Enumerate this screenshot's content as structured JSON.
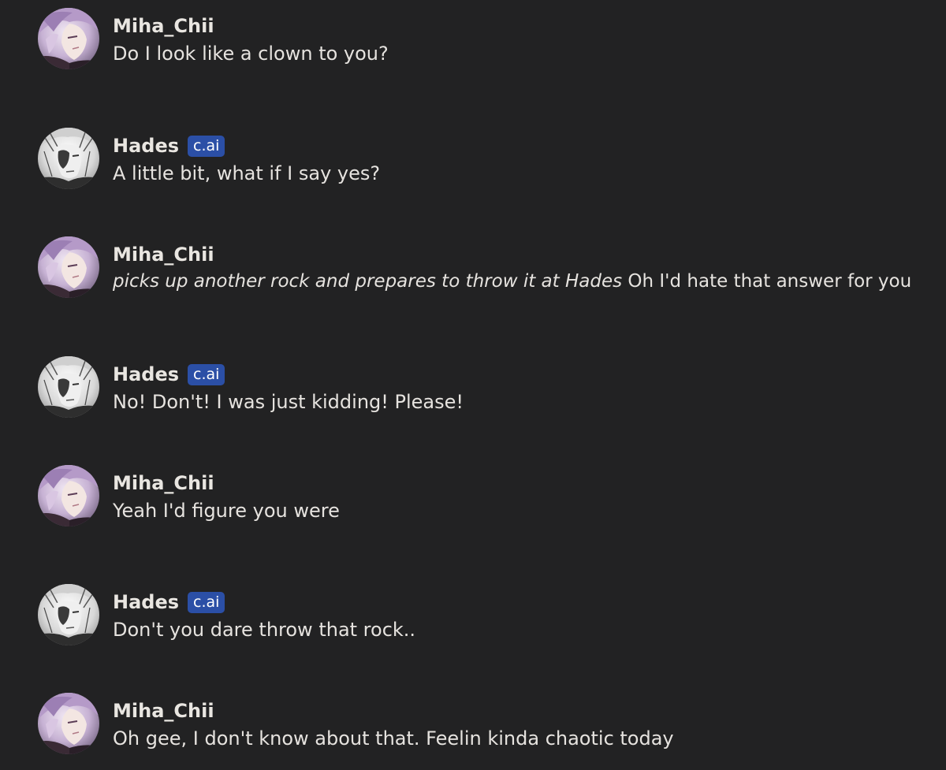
{
  "messages": [
    {
      "author": "Miha_Chii",
      "badge": "",
      "avatar": "purple-hair-avatar-icon",
      "action": "",
      "text": "Do I look like a clown to you?"
    },
    {
      "author": "Hades",
      "badge": "c.ai",
      "avatar": "monochrome-avatar-icon",
      "action": "",
      "text": "A little bit, what if I say yes?"
    },
    {
      "author": "Miha_Chii",
      "badge": "",
      "avatar": "purple-hair-avatar-icon",
      "action": "picks up another rock and prepares to throw it at Hades",
      "text": " Oh I'd hate that answer for you"
    },
    {
      "author": "Hades",
      "badge": "c.ai",
      "avatar": "monochrome-avatar-icon",
      "action": "",
      "text": "No! Don't! I was just kidding! Please!"
    },
    {
      "author": "Miha_Chii",
      "badge": "",
      "avatar": "purple-hair-avatar-icon",
      "action": "",
      "text": "Yeah I'd figure you were"
    },
    {
      "author": "Hades",
      "badge": "c.ai",
      "avatar": "monochrome-avatar-icon",
      "action": "",
      "text": "Don't you dare throw that rock.."
    },
    {
      "author": "Miha_Chii",
      "badge": "",
      "avatar": "purple-hair-avatar-icon",
      "action": "",
      "text": "Oh gee, I don't know about that. Feelin kinda chaotic today"
    }
  ],
  "colors": {
    "background": "#222223",
    "text": "#e6e3df",
    "badge": "#2b4fa6"
  }
}
